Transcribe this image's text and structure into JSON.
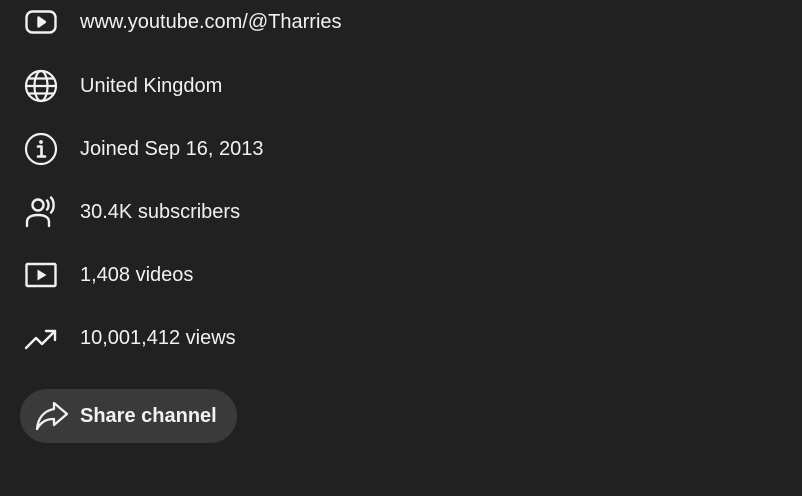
{
  "about": {
    "items": [
      {
        "icon": "youtube-play-icon",
        "text": "www.youtube.com/@Tharries"
      },
      {
        "icon": "globe-icon",
        "text": "United Kingdom"
      },
      {
        "icon": "info-icon",
        "text": "Joined Sep 16, 2013"
      },
      {
        "icon": "subscribers-icon",
        "text": "30.4K subscribers"
      },
      {
        "icon": "video-icon",
        "text": "1,408 videos"
      },
      {
        "icon": "trending-icon",
        "text": "10,001,412 views"
      }
    ],
    "share_label": "Share channel",
    "share_icon": "share-arrow-icon"
  },
  "colors": {
    "background": "#212121",
    "text": "#f1f1f1",
    "button_bg": "#3a3a3a"
  }
}
